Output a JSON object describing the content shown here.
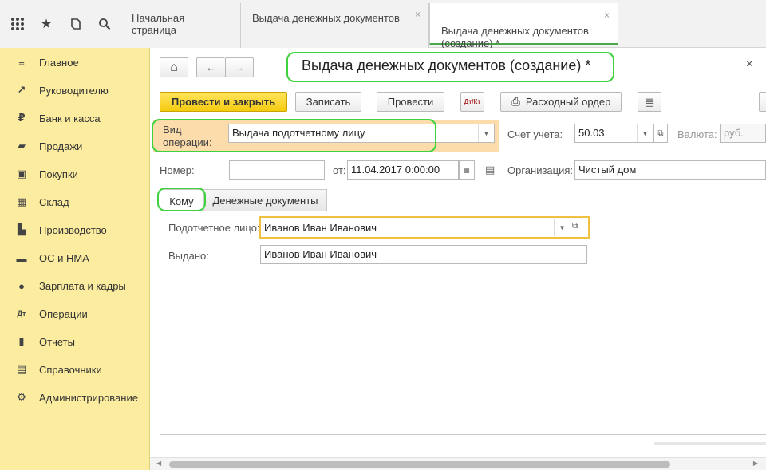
{
  "top_icons": [
    {
      "name": "apps-grid-icon",
      "glyph": "⋮⋮⋮"
    },
    {
      "name": "favorites-star-icon",
      "glyph": "★"
    },
    {
      "name": "history-icon",
      "glyph": "⎌"
    },
    {
      "name": "search-icon",
      "glyph": "⚲"
    }
  ],
  "tabs": [
    {
      "label": "Начальная страница",
      "close": ""
    },
    {
      "label": "Выдача денежных документов",
      "close": "×"
    },
    {
      "label": "Выдача денежных документов\n(создание) *",
      "close": "×"
    }
  ],
  "sidebar": {
    "items": [
      {
        "icon": "menu-lines-icon",
        "glyph": "≡",
        "label": "Главное"
      },
      {
        "icon": "trend-chart-icon",
        "glyph": "↗",
        "label": "Руководителю"
      },
      {
        "icon": "ruble-coin-icon",
        "glyph": "₽",
        "label": "Банк и касса"
      },
      {
        "icon": "shopping-bag-icon",
        "glyph": "▰",
        "label": "Продажи"
      },
      {
        "icon": "shopping-cart-icon",
        "glyph": "▣",
        "label": "Покупки"
      },
      {
        "icon": "warehouse-grid-icon",
        "glyph": "▦",
        "label": "Склад"
      },
      {
        "icon": "factory-icon",
        "glyph": "▙",
        "label": "Производство"
      },
      {
        "icon": "truck-icon",
        "glyph": "▬",
        "label": "ОС и НМА"
      },
      {
        "icon": "person-icon",
        "glyph": "●",
        "label": "Зарплата и кадры"
      },
      {
        "icon": "debit-credit-icon",
        "glyph": "Дт",
        "label": "Операции"
      },
      {
        "icon": "bar-chart-icon",
        "glyph": "▮",
        "label": "Отчеты"
      },
      {
        "icon": "reference-book-icon",
        "glyph": "▤",
        "label": "Справочники"
      },
      {
        "icon": "gear-icon",
        "glyph": "⚙",
        "label": "Администрирование"
      }
    ]
  },
  "nav": {
    "home_glyph": "⌂",
    "back_glyph": "←",
    "forward_glyph": "→"
  },
  "document": {
    "title": "Выдача денежных документов (создание) *",
    "close_glyph": "×"
  },
  "toolbar": {
    "post_close": "Провести и закрыть",
    "save": "Записать",
    "post": "Провести",
    "dt_kt_glyph": "Дт/Кт",
    "print_glyph": "⎙",
    "expense_order": "Расходный ордер",
    "report_glyph": "▤"
  },
  "form": {
    "operation_label": "Вид\nоперации:",
    "operation_value": "Выдача подотчетному лицу",
    "account_label": "Счет учета:",
    "account_value": "50.03",
    "currency_label": "Валюта:",
    "currency_value": "руб.",
    "number_label": "Номер:",
    "number_value": "",
    "date_label": "от:",
    "date_value": "11.04.2017  0:00:00",
    "org_label": "Организация:",
    "org_value": "Чистый дом"
  },
  "subtabs": [
    {
      "label": "Кому"
    },
    {
      "label": "Денежные документы"
    }
  ],
  "recipient": {
    "person_label": "Подотчетное лицо:",
    "person_value": "Иванов Иван Иванович",
    "issued_label": "Выдано:",
    "issued_value": "Иванов Иван Иванович"
  },
  "colors": {
    "accent": "#f5cb10",
    "sidebar": "#fbeca0",
    "highlight": "#3fd23f",
    "focus": "#f0c040"
  }
}
